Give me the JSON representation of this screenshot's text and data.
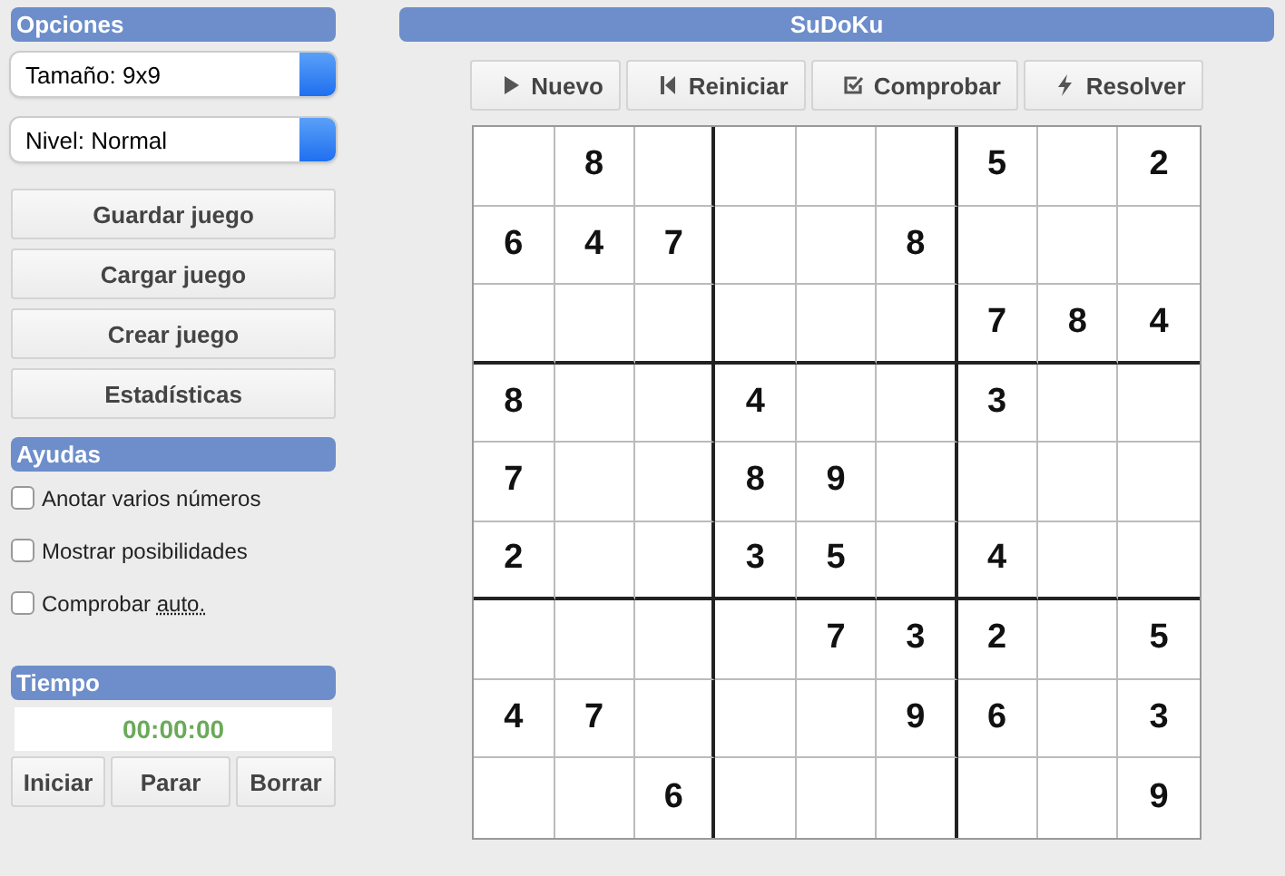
{
  "sidebar": {
    "options": {
      "title": "Opciones",
      "selects": [
        {
          "value": "Tamaño: 9x9"
        },
        {
          "value": "Nivel: Normal"
        }
      ],
      "buttons": [
        "Guardar juego",
        "Cargar juego",
        "Crear juego",
        "Estadísticas"
      ]
    },
    "helps": {
      "title": "Ayudas",
      "checkboxes": [
        {
          "label": "Anotar varios números",
          "checked": false
        },
        {
          "label": "Mostrar posibilidades",
          "checked": false
        },
        {
          "label": "Comprobar",
          "abbr": "auto.",
          "checked": false
        }
      ]
    },
    "timer": {
      "title": "Tiempo",
      "time": "00:00:00",
      "buttons": [
        "Iniciar",
        "Parar",
        "Borrar"
      ]
    }
  },
  "main": {
    "title": "SuDoKu",
    "toolbar": [
      {
        "label": "Nuevo",
        "kind": "play"
      },
      {
        "label": "Reiniciar",
        "kind": "rewind"
      },
      {
        "label": "Comprobar",
        "kind": "check"
      },
      {
        "label": "Resolver",
        "kind": "bolt"
      }
    ],
    "grid": [
      [
        {
          "kind": "empty"
        },
        {
          "kind": "given",
          "value": "8"
        },
        {
          "kind": "empty"
        },
        {
          "kind": "empty"
        },
        {
          "kind": "empty"
        },
        {
          "kind": "empty"
        },
        {
          "kind": "given",
          "value": "5"
        },
        {
          "kind": "empty"
        },
        {
          "kind": "given",
          "value": "2"
        }
      ],
      [
        {
          "kind": "given",
          "value": "6"
        },
        {
          "kind": "given",
          "value": "4"
        },
        {
          "kind": "given",
          "value": "7"
        },
        {
          "kind": "empty"
        },
        {
          "kind": "empty"
        },
        {
          "kind": "given",
          "value": "8"
        },
        {
          "kind": "empty"
        },
        {
          "kind": "empty"
        },
        {
          "kind": "empty"
        }
      ],
      [
        {
          "kind": "empty"
        },
        {
          "kind": "empty"
        },
        {
          "kind": "empty"
        },
        {
          "kind": "empty"
        },
        {
          "kind": "empty"
        },
        {
          "kind": "empty"
        },
        {
          "kind": "given",
          "value": "7"
        },
        {
          "kind": "given",
          "value": "8"
        },
        {
          "kind": "given",
          "value": "4"
        }
      ],
      [
        {
          "kind": "given",
          "value": "8"
        },
        {
          "kind": "empty"
        },
        {
          "kind": "empty"
        },
        {
          "kind": "given",
          "value": "4"
        },
        {
          "kind": "empty"
        },
        {
          "kind": "empty"
        },
        {
          "kind": "given",
          "value": "3"
        },
        {
          "kind": "empty"
        },
        {
          "kind": "empty"
        }
      ],
      [
        {
          "kind": "given",
          "value": "7"
        },
        {
          "kind": "empty"
        },
        {
          "kind": "empty"
        },
        {
          "kind": "given",
          "value": "8"
        },
        {
          "kind": "given",
          "value": "9"
        },
        {
          "kind": "empty"
        },
        {
          "kind": "empty"
        },
        {
          "kind": "empty"
        },
        {
          "kind": "empty"
        }
      ],
      [
        {
          "kind": "given",
          "value": "2"
        },
        {
          "kind": "empty"
        },
        {
          "kind": "empty"
        },
        {
          "kind": "given",
          "value": "3"
        },
        {
          "kind": "given",
          "value": "5"
        },
        {
          "kind": "empty"
        },
        {
          "kind": "given",
          "value": "4"
        },
        {
          "kind": "empty"
        },
        {
          "kind": "empty"
        }
      ],
      [
        {
          "kind": "empty"
        },
        {
          "kind": "empty"
        },
        {
          "kind": "empty"
        },
        {
          "kind": "empty"
        },
        {
          "kind": "given",
          "value": "7"
        },
        {
          "kind": "given",
          "value": "3"
        },
        {
          "kind": "given",
          "value": "2"
        },
        {
          "kind": "empty"
        },
        {
          "kind": "given",
          "value": "5"
        }
      ],
      [
        {
          "kind": "given",
          "value": "4"
        },
        {
          "kind": "given",
          "value": "7"
        },
        {
          "kind": "empty"
        },
        {
          "kind": "empty"
        },
        {
          "kind": "empty"
        },
        {
          "kind": "given",
          "value": "9"
        },
        {
          "kind": "given",
          "value": "6"
        },
        {
          "kind": "empty"
        },
        {
          "kind": "given",
          "value": "3"
        }
      ],
      [
        {
          "kind": "empty"
        },
        {
          "kind": "empty"
        },
        {
          "kind": "given",
          "value": "6"
        },
        {
          "kind": "empty"
        },
        {
          "kind": "empty"
        },
        {
          "kind": "empty"
        },
        {
          "kind": "empty"
        },
        {
          "kind": "empty"
        },
        {
          "kind": "given",
          "value": "9"
        }
      ]
    ]
  }
}
